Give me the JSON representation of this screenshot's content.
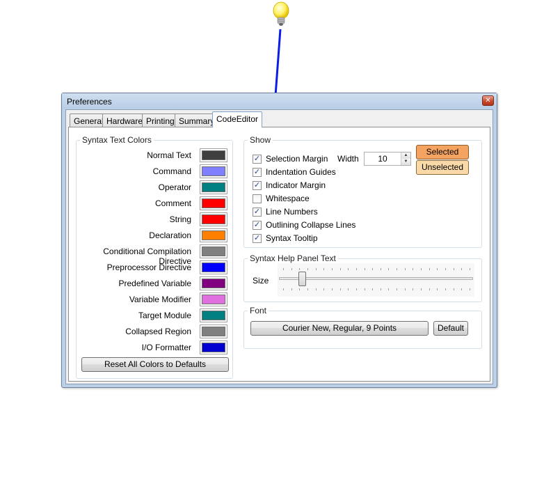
{
  "window": {
    "title": "Preferences",
    "close_glyph": "✕"
  },
  "tabs": [
    {
      "label": "General"
    },
    {
      "label": "Hardware"
    },
    {
      "label": "Printing"
    },
    {
      "label": "Summary"
    },
    {
      "label": "CodeEditor",
      "active": true
    }
  ],
  "syntax_colors": {
    "group_label": "Syntax Text Colors",
    "items": [
      {
        "label": "Normal Text",
        "color": "#404040"
      },
      {
        "label": "Command",
        "color": "#8080ff"
      },
      {
        "label": "Operator",
        "color": "#008080"
      },
      {
        "label": "Comment",
        "color": "#ff0000"
      },
      {
        "label": "String",
        "color": "#ff0000"
      },
      {
        "label": "Declaration",
        "color": "#ff8000"
      },
      {
        "label": "Conditional Compilation Directive",
        "color": "#808080"
      },
      {
        "label": "Preprocessor Directive",
        "color": "#0000ff"
      },
      {
        "label": "Predefined Variable",
        "color": "#800080"
      },
      {
        "label": "Variable Modifier",
        "color": "#e070e0"
      },
      {
        "label": "Target Module",
        "color": "#008080"
      },
      {
        "label": "Collapsed Region",
        "color": "#808080"
      },
      {
        "label": "I/O Formatter",
        "color": "#0000d0"
      }
    ],
    "reset_button": "Reset All Colors to Defaults"
  },
  "show": {
    "group_label": "Show",
    "options": [
      {
        "label": "Selection Margin",
        "checked": true
      },
      {
        "label": "Indentation Guides",
        "checked": true
      },
      {
        "label": "Indicator Margin",
        "checked": true
      },
      {
        "label": "Whitespace",
        "checked": false
      },
      {
        "label": "Line Numbers",
        "checked": true
      },
      {
        "label": "Outlining Collapse Lines",
        "checked": true
      },
      {
        "label": "Syntax Tooltip",
        "checked": true
      }
    ],
    "width_label": "Width",
    "width_value": "10",
    "selected_button": "Selected",
    "selected_color": "#f4a460",
    "unselected_button": "Unselected",
    "unselected_color": "#f9d9a8"
  },
  "help_panel": {
    "group_label": "Syntax Help Panel Text",
    "size_label": "Size",
    "slider_fraction": 0.1
  },
  "font": {
    "group_label": "Font",
    "font_button": "Courier New, Regular, 9 Points",
    "default_button": "Default"
  },
  "annotation": {
    "icon": "lightbulb-icon",
    "arrow_color": "#0a1ee6"
  }
}
